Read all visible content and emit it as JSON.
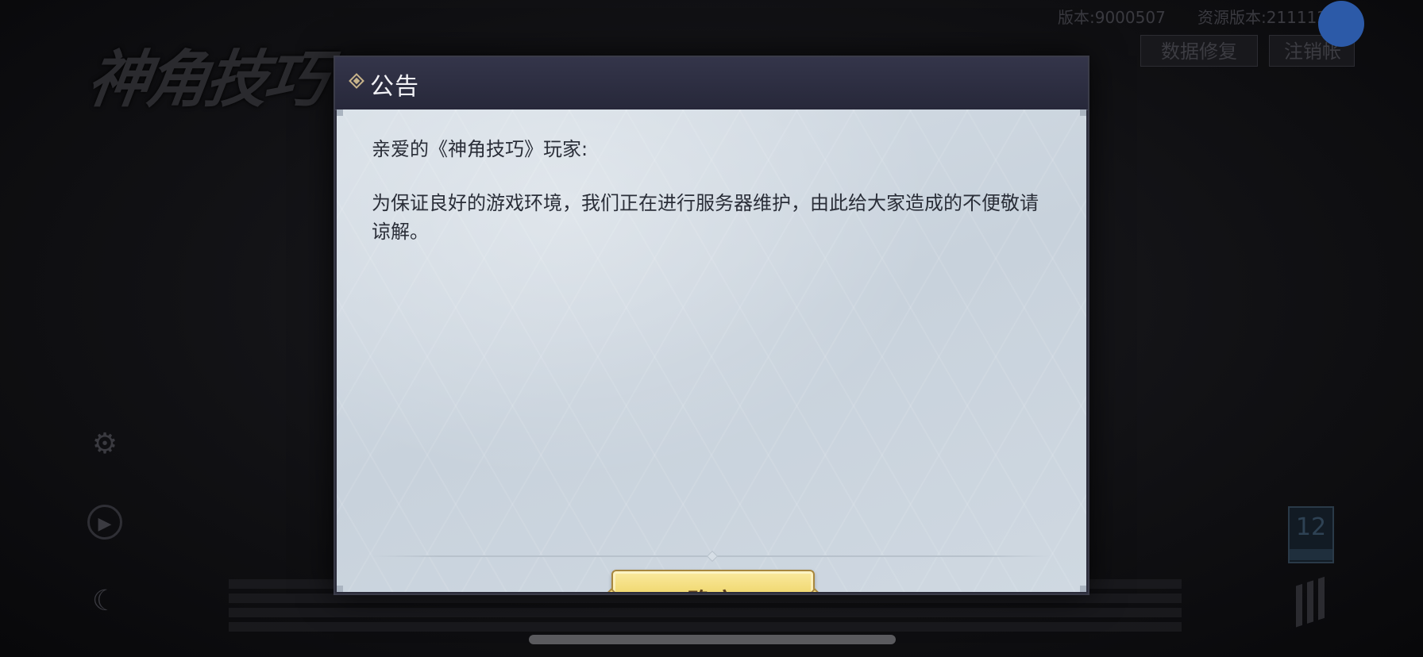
{
  "background": {
    "logo_text": "神角技巧",
    "version_label": "版本:9000507",
    "resource_version_label": "资源版本:2111120",
    "data_repair_button": "数据修复",
    "logout_button": "注销帐",
    "age_rating": "12"
  },
  "dialog": {
    "title": "公告",
    "greeting": "亲爱的《神角技巧》玩家:",
    "message": "为保证良好的游戏环境，我们正在进行服务器维护，由此给大家造成的不便敬请谅解。",
    "confirm_label": "确定"
  },
  "colors": {
    "header_bg": "#2b2c3a",
    "body_bg": "#d6dee6",
    "button_gold": "#f0d870",
    "button_text": "#5b3e1c",
    "assist_blue": "#2c5aa8"
  }
}
